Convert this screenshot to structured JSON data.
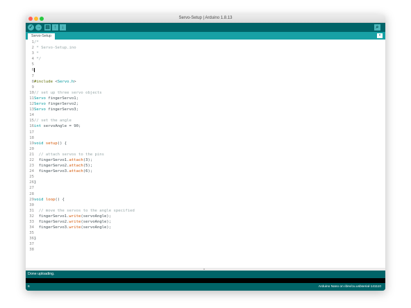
{
  "window": {
    "title": "Servo-Setup | Arduino 1.8.13"
  },
  "toolbar": {
    "buttons": [
      {
        "name": "verify",
        "icon": "check-icon"
      },
      {
        "name": "upload",
        "icon": "arrow-right-icon"
      },
      {
        "name": "new",
        "icon": "new-file-icon"
      },
      {
        "name": "open",
        "icon": "arrow-up-icon"
      },
      {
        "name": "save",
        "icon": "arrow-down-icon"
      },
      {
        "name": "serial-monitor",
        "icon": "magnifier-icon"
      }
    ]
  },
  "tabs": [
    {
      "label": "Servo-Setup",
      "active": true
    }
  ],
  "editor": {
    "cursor_line": 6,
    "lines": [
      {
        "n": "1",
        "t": "/*"
      },
      {
        "n": "2",
        "t": " * Servo-Setup.ino"
      },
      {
        "n": "3",
        "t": " *"
      },
      {
        "n": "4",
        "t": " */"
      },
      {
        "n": "5",
        "t": ""
      },
      {
        "n": "6",
        "t": ""
      },
      {
        "n": "7",
        "t": ""
      },
      {
        "n": "8",
        "t": "#include <Servo.h>"
      },
      {
        "n": "9",
        "t": ""
      },
      {
        "n": "10",
        "t": "// set up three servo objects"
      },
      {
        "n": "11",
        "t": "Servo fingerServo1;"
      },
      {
        "n": "12",
        "t": "Servo fingerServo2;"
      },
      {
        "n": "13",
        "t": "Servo fingerServo3;"
      },
      {
        "n": "14",
        "t": ""
      },
      {
        "n": "15",
        "t": "// set the angle"
      },
      {
        "n": "16",
        "t": "int servoAngle = 90;"
      },
      {
        "n": "17",
        "t": ""
      },
      {
        "n": "18",
        "t": ""
      },
      {
        "n": "19",
        "t": "void setup() {"
      },
      {
        "n": "20",
        "t": ""
      },
      {
        "n": "21",
        "t": "  // attach servos to the pins"
      },
      {
        "n": "22",
        "t": "  fingerServo1.attach(3);"
      },
      {
        "n": "23",
        "t": "  fingerServo2.attach(5);"
      },
      {
        "n": "24",
        "t": "  fingerServo3.attach(6);"
      },
      {
        "n": "25",
        "t": ""
      },
      {
        "n": "26",
        "t": "}"
      },
      {
        "n": "27",
        "t": ""
      },
      {
        "n": "28",
        "t": ""
      },
      {
        "n": "29",
        "t": "void loop() {"
      },
      {
        "n": "30",
        "t": ""
      },
      {
        "n": "31",
        "t": "  // move the servos to the angle specified"
      },
      {
        "n": "32",
        "t": "  fingerServo1.write(servoAngle);"
      },
      {
        "n": "33",
        "t": "  fingerServo2.write(servoAngle);"
      },
      {
        "n": "34",
        "t": "  fingerServo3.write(servoAngle);"
      },
      {
        "n": "35",
        "t": ""
      },
      {
        "n": "36",
        "t": "}"
      },
      {
        "n": "37",
        "t": ""
      },
      {
        "n": "38",
        "t": ""
      }
    ]
  },
  "status": {
    "message": "Done uploading."
  },
  "footer": {
    "line_number": "6",
    "board_info": "Arduino Nano on /dev/cu.usbserial-141110"
  },
  "colors": {
    "toolbar": "#006468",
    "tabbar": "#17a1a5",
    "keyword": "#00979c",
    "function": "#d35400",
    "comment": "#95a5a6",
    "preprocessor": "#5e6d03"
  }
}
